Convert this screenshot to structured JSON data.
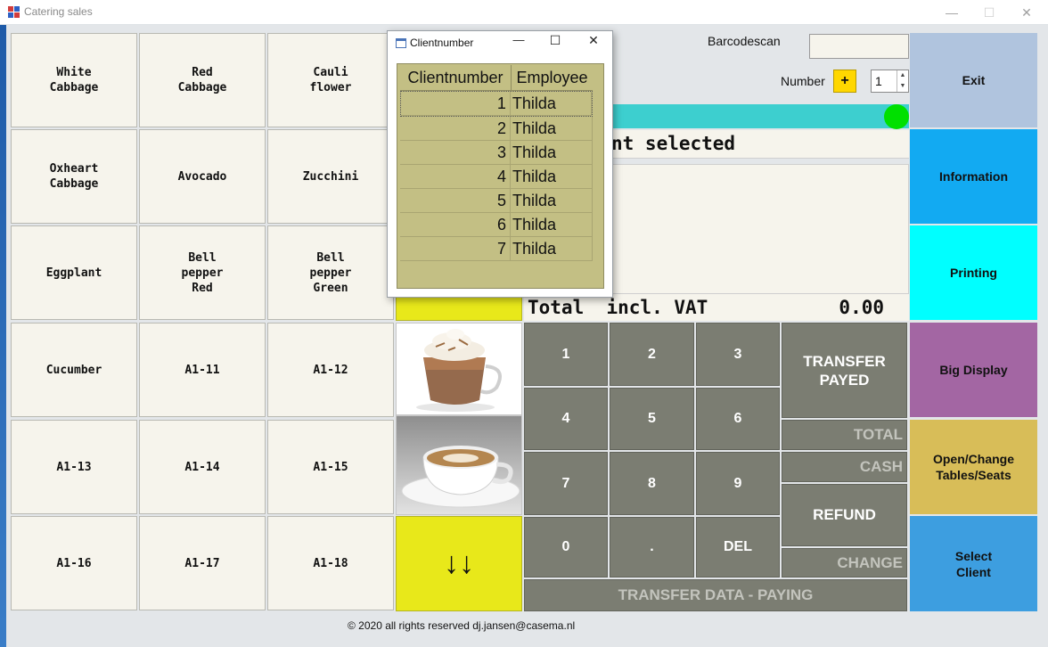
{
  "window": {
    "title": "Catering sales",
    "minimize": "—",
    "maximize": "☐",
    "close": "✕"
  },
  "products": [
    [
      "White\nCabbage",
      "Red\nCabbage",
      "Cauli\nflower"
    ],
    [
      "Oxheart\nCabbage",
      "Avocado",
      "Zucchini"
    ],
    [
      "Eggplant",
      "Bell\npepper\nRed",
      "Bell\npepper\nGreen"
    ],
    [
      "Cucumber",
      "A1-11",
      "A1-12"
    ],
    [
      "A1-13",
      "A1-14",
      "A1-15"
    ],
    [
      "A1-16",
      "A1-17",
      "A1-18"
    ]
  ],
  "images": {
    "item1": "hot chocolate with whipped cream",
    "item2": "cappuccino cup"
  },
  "scroll_down": "↓↓",
  "barcode": {
    "label": "Barcodescan",
    "value": ""
  },
  "number": {
    "label": "Number",
    "plus": "+",
    "value": "1"
  },
  "client_status": "nt selected",
  "total": {
    "label": "Total  incl. VAT",
    "amount": "0.00"
  },
  "keypad": {
    "keys": [
      "1",
      "2",
      "3",
      "4",
      "5",
      "6",
      "7",
      "8",
      "9",
      "0",
      ".",
      "DEL"
    ],
    "transfer_payed": "TRANSFER\nPAYED",
    "total": "TOTAL",
    "cash": "CASH",
    "refund": "REFUND",
    "change": "CHANGE",
    "transfer_data": "TRANSFER DATA - PAYING"
  },
  "sidebar": {
    "exit": "Exit",
    "information": "Information",
    "printing": "Printing",
    "big_display": "Big Display",
    "open_change": "Open/Change\nTables/Seats",
    "select_client": "Select\nClient"
  },
  "footer": "© 2020 all rights reserved dj.jansen@casema.nl",
  "dialog": {
    "title": "Clientnumber",
    "minimize": "—",
    "maximize": "☐",
    "close": "✕",
    "columns": [
      "Clientnumber",
      "Employee"
    ],
    "rows": [
      [
        "1",
        "Thilda"
      ],
      [
        "2",
        "Thilda"
      ],
      [
        "3",
        "Thilda"
      ],
      [
        "4",
        "Thilda"
      ],
      [
        "5",
        "Thilda"
      ],
      [
        "6",
        "Thilda"
      ],
      [
        "7",
        "Thilda"
      ]
    ]
  },
  "colors": {
    "exit": "#b0c4de",
    "information": "#12aaf2",
    "printing": "#00ffff",
    "big_display": "#a366a3",
    "open_change": "#d8bd58",
    "select_client": "#3d9ee0",
    "status_bar": "#3dcfcf",
    "indicator": "#00e000",
    "yellow": "#e8e81a",
    "keypad": "#7b7d72"
  }
}
